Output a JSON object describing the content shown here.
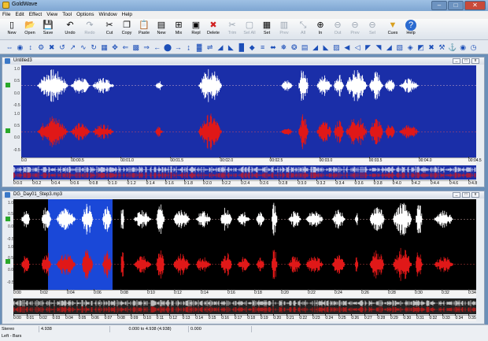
{
  "app": {
    "title": "GoldWave"
  },
  "menu": [
    "File",
    "Edit",
    "Effect",
    "View",
    "Tool",
    "Options",
    "Window",
    "Help"
  ],
  "toolbar": [
    {
      "label": "New",
      "icon": "new-file-icon",
      "glyph": "▯",
      "enabled": true
    },
    {
      "label": "Open",
      "icon": "open-folder-icon",
      "glyph": "📂",
      "enabled": true
    },
    {
      "label": "Save",
      "icon": "save-icon",
      "glyph": "💾",
      "enabled": true
    },
    {
      "label": "Undo",
      "icon": "undo-icon",
      "glyph": "↶",
      "enabled": true
    },
    {
      "label": "Redo",
      "icon": "redo-icon",
      "glyph": "↷",
      "enabled": false
    },
    {
      "label": "Cut",
      "icon": "cut-icon",
      "glyph": "✂",
      "enabled": true
    },
    {
      "label": "Copy",
      "icon": "copy-icon",
      "glyph": "❐",
      "enabled": true
    },
    {
      "label": "Paste",
      "icon": "paste-icon",
      "glyph": "📋",
      "enabled": true
    },
    {
      "label": "New",
      "icon": "paste-new-icon",
      "glyph": "▤",
      "enabled": true
    },
    {
      "label": "Mix",
      "icon": "mix-icon",
      "glyph": "⊞",
      "enabled": true
    },
    {
      "label": "Repl",
      "icon": "replace-icon",
      "glyph": "▣",
      "enabled": true
    },
    {
      "label": "Delete",
      "icon": "delete-icon",
      "glyph": "✖",
      "enabled": true
    },
    {
      "label": "Trim",
      "icon": "trim-icon",
      "glyph": "✂",
      "enabled": false
    },
    {
      "label": "Sel All",
      "icon": "select-all-icon",
      "glyph": "▢",
      "enabled": false
    },
    {
      "label": "Set",
      "icon": "set-icon",
      "glyph": "▦",
      "enabled": true
    },
    {
      "label": "Prev",
      "icon": "previous-icon",
      "glyph": "▥",
      "enabled": false
    },
    {
      "label": "All",
      "icon": "zoom-all-icon",
      "glyph": "⤡",
      "enabled": false
    },
    {
      "label": "In",
      "icon": "zoom-in-icon",
      "glyph": "⊕",
      "enabled": true
    },
    {
      "label": "Out",
      "icon": "zoom-out-icon",
      "glyph": "⊖",
      "enabled": false
    },
    {
      "label": "Prev",
      "icon": "zoom-previous-icon",
      "glyph": "⊖",
      "enabled": false
    },
    {
      "label": "Sel",
      "icon": "zoom-selection-icon",
      "glyph": "⊖",
      "enabled": false
    },
    {
      "label": "Cues",
      "icon": "cues-icon",
      "glyph": "▼",
      "enabled": true
    },
    {
      "label": "Help",
      "icon": "help-icon",
      "glyph": "?",
      "enabled": true
    }
  ],
  "effects_bar": [
    {
      "icon": "stretch-icon",
      "glyph": "⇔"
    },
    {
      "icon": "noise-reduction-icon",
      "glyph": "◉"
    },
    {
      "icon": "expand-icon",
      "glyph": "↕"
    },
    {
      "icon": "mechanize-icon",
      "glyph": "⚙"
    },
    {
      "icon": "compressor-icon",
      "glyph": "✖"
    },
    {
      "icon": "doppler-icon",
      "glyph": "↺"
    },
    {
      "icon": "fade-icon",
      "glyph": "↗"
    },
    {
      "icon": "echo-icon",
      "glyph": "∿"
    },
    {
      "icon": "loop-icon",
      "glyph": "↻"
    },
    {
      "icon": "resample-icon",
      "glyph": "▦"
    },
    {
      "icon": "pan-icon",
      "glyph": "✥"
    },
    {
      "icon": "reverse-icon",
      "glyph": "⇐"
    },
    {
      "icon": "filter-icon",
      "glyph": "▩"
    },
    {
      "icon": "forward-icon",
      "glyph": "⇒"
    },
    {
      "icon": "back-icon",
      "glyph": "←"
    },
    {
      "icon": "balance-icon",
      "glyph": "⬤"
    },
    {
      "icon": "next-icon",
      "glyph": "→"
    },
    {
      "icon": "invert-icon",
      "glyph": "↨"
    },
    {
      "icon": "equalizer-icon",
      "glyph": "▓"
    },
    {
      "icon": "shift-icon",
      "glyph": "⇌"
    },
    {
      "icon": "lowpass-icon",
      "glyph": "◢"
    },
    {
      "icon": "highpass-icon",
      "glyph": "◣"
    },
    {
      "icon": "spectrum-icon",
      "glyph": "█"
    },
    {
      "icon": "pitch-icon",
      "glyph": "◆"
    },
    {
      "icon": "tone-icon",
      "glyph": "≡"
    },
    {
      "icon": "offset-icon",
      "glyph": "⬌"
    },
    {
      "icon": "chorus-icon",
      "glyph": "❅"
    },
    {
      "icon": "flanger-icon",
      "glyph": "❂"
    },
    {
      "icon": "volume-icon",
      "glyph": "▤"
    },
    {
      "icon": "volume-up-icon",
      "glyph": "◢"
    },
    {
      "icon": "volume-down-icon",
      "glyph": "◣"
    },
    {
      "icon": "match-icon",
      "glyph": "▨"
    },
    {
      "icon": "speaker-icon",
      "glyph": "◀"
    },
    {
      "icon": "mute-icon",
      "glyph": "◁"
    },
    {
      "icon": "vol-shape-icon",
      "glyph": "◤"
    },
    {
      "icon": "normalize-icon",
      "glyph": "◥"
    },
    {
      "icon": "maximize-icon",
      "glyph": "◢"
    },
    {
      "icon": "quantize-icon",
      "glyph": "▧"
    },
    {
      "icon": "stereo-icon",
      "glyph": "◈"
    },
    {
      "icon": "channel-icon",
      "glyph": "◩"
    },
    {
      "icon": "dropout-icon",
      "glyph": "✖"
    },
    {
      "icon": "declick-icon",
      "glyph": "⚒"
    },
    {
      "icon": "clip-icon",
      "glyph": "⚓"
    },
    {
      "icon": "cd-icon",
      "glyph": "◉"
    },
    {
      "icon": "timer-icon",
      "glyph": "◷"
    }
  ],
  "doc1": {
    "title": "Untitled3",
    "scale": [
      "1.0",
      "0.5",
      "0.0",
      "-0.5",
      "1.0",
      "0.5",
      "0.0",
      "-0.5"
    ],
    "ruler": [
      "0.0",
      "00:00.5",
      "00:01.0",
      "00:01.5",
      "00:02.0",
      "00:02.5",
      "00:03.0",
      "00:03.5",
      "00:04.0",
      "00:04.5"
    ],
    "overview_ruler": [
      "0:0.0",
      "0:0.2",
      "0:0.4",
      "0:0.6",
      "0:0.8",
      "0:1.0",
      "0:1.2",
      "0:1.4",
      "0:1.6",
      "0:1.8",
      "0:2.0",
      "0:2.2",
      "0:2.4",
      "0:2.6",
      "0:2.8",
      "0:3.0",
      "0:3.2",
      "0:3.4",
      "0:3.6",
      "0:3.8",
      "0:4.0",
      "0:4.2",
      "0:4.4",
      "0:4.6",
      "0:4.8"
    ],
    "background": "#1a2ea8"
  },
  "doc2": {
    "title": "DG_Day01_Step3.mp3",
    "scale": [
      "1.0",
      "0.5",
      "0.0",
      "-0.5",
      "1.0",
      "0.5",
      "0.0",
      "-0.5"
    ],
    "ruler": [
      "0:00",
      "0:02",
      "0:04",
      "0:06",
      "0:08",
      "0:10",
      "0:12",
      "0:14",
      "0:16",
      "0:18",
      "0:20",
      "0:22",
      "0:24",
      "0:26",
      "0:28",
      "0:30",
      "0:32",
      "0:34"
    ],
    "overview_ruler": [
      "0:00",
      "0:01",
      "0:02",
      "0:03",
      "0:04",
      "0:05",
      "0:06",
      "0:07",
      "0:08",
      "0:09",
      "0:10",
      "0:11",
      "0:12",
      "0:13",
      "0:14",
      "0:15",
      "0:16",
      "0:17",
      "0:18",
      "0:19",
      "0:20",
      "0:21",
      "0:22",
      "0:23",
      "0:24",
      "0:25",
      "0:26",
      "0:27",
      "0:28",
      "0:29",
      "0:30",
      "0:31",
      "0:32",
      "0:33",
      "0:34",
      "0:35"
    ],
    "background": "#000000",
    "selection_color": "#1a48d8"
  },
  "status": {
    "channels": "Stereo",
    "length": "4.938",
    "range": "0.000 to 4.938 (4.938)",
    "position": "0.000",
    "hint": "Left - Bars"
  },
  "colors": {
    "left_wave": "#ffffff",
    "right_wave": "#e01818"
  }
}
